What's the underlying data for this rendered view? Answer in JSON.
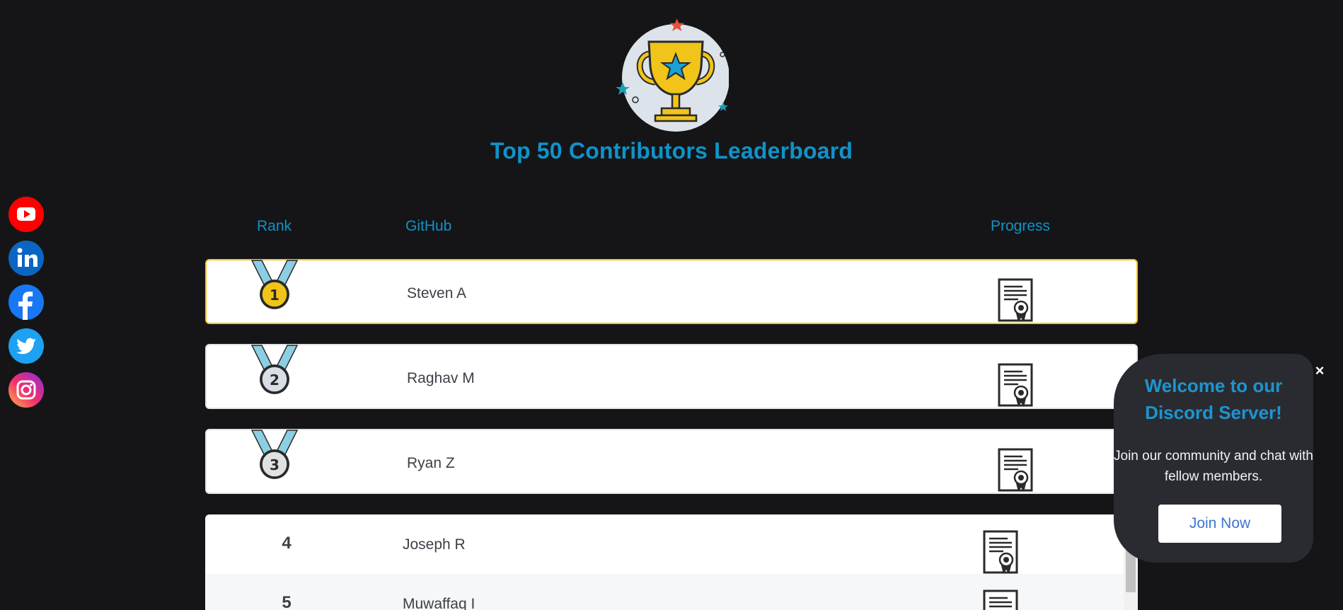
{
  "header": {
    "title": "Top 50 Contributors Leaderboard",
    "icon": "trophy-icon"
  },
  "social": [
    {
      "name": "youtube",
      "icon": "youtube-icon",
      "color": "#ff0000"
    },
    {
      "name": "linkedin",
      "icon": "linkedin-icon",
      "color": "#0a66c2"
    },
    {
      "name": "facebook",
      "icon": "facebook-icon",
      "color": "#1877f2"
    },
    {
      "name": "twitter",
      "icon": "twitter-icon",
      "color": "#1da1f2"
    },
    {
      "name": "instagram",
      "icon": "instagram-icon",
      "color": "#d6249f"
    }
  ],
  "table": {
    "columns": [
      "Rank",
      "GitHub",
      "Progress"
    ],
    "top_rows": [
      {
        "rank": "1",
        "name": "Steven A",
        "medal": "gold-medal-icon",
        "medal_color": "#f0c419"
      },
      {
        "rank": "2",
        "name": "Raghav M",
        "medal": "silver-medal-icon",
        "medal_color": "#d9dde6"
      },
      {
        "rank": "3",
        "name": "Ryan Z",
        "medal": "bronze-medal-icon",
        "medal_color": "#dfe1e3"
      }
    ],
    "rows": [
      {
        "rank": "4",
        "name": "Joseph R"
      },
      {
        "rank": "5",
        "name": "Muwaffaq I"
      }
    ],
    "progress_icon": "certificate-icon"
  },
  "popup": {
    "title": "Welcome to our Discord Server!",
    "text": "Join our community and chat with fellow members.",
    "button": "Join Now",
    "close": "×"
  },
  "colors": {
    "background": "#151518",
    "accent": "#0f93c9",
    "gold": "#f2c81c"
  }
}
